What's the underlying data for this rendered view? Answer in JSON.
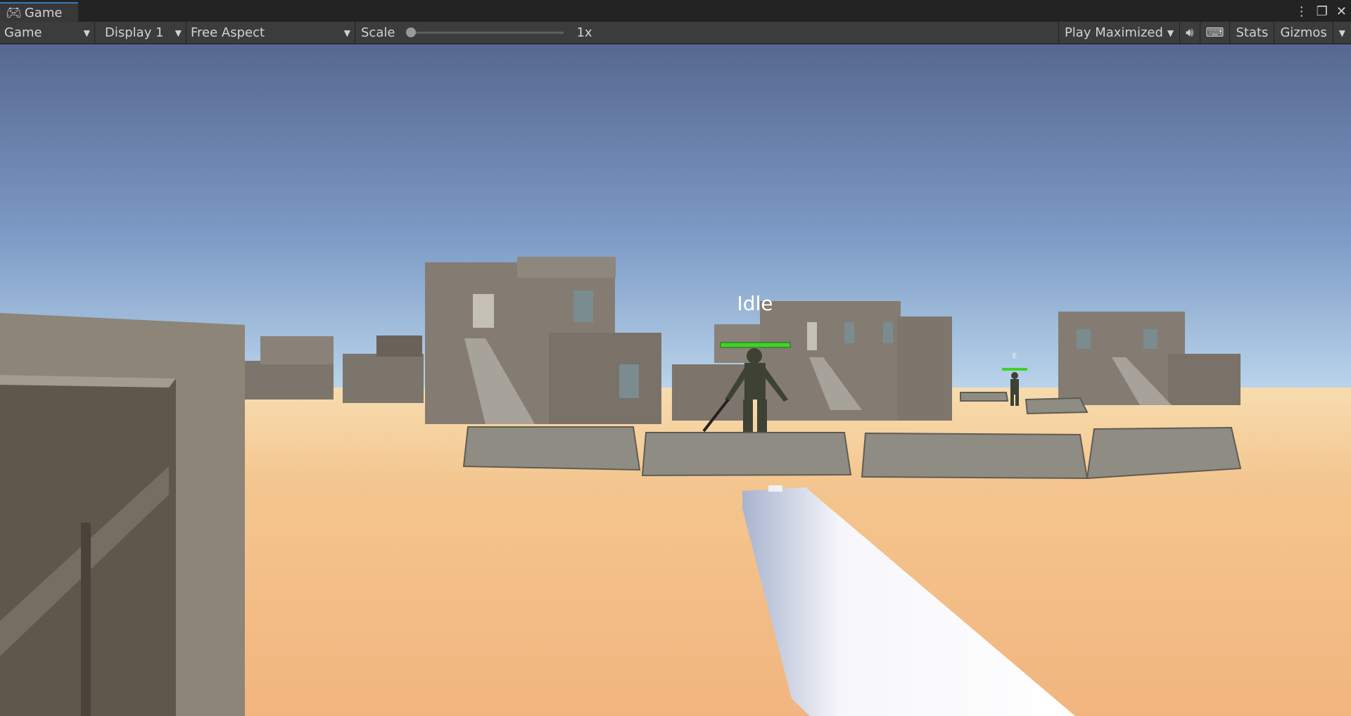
{
  "tab": {
    "icon": "gamepad-icon",
    "label": "Game"
  },
  "toolbar": {
    "mode": "Game",
    "display": "Display 1",
    "aspect": "Free Aspect",
    "scale_label": "Scale",
    "scale_value": "1x",
    "scale_fraction": 0,
    "play_mode": "Play Maximized",
    "stats": "Stats",
    "gizmos": "Gizmos"
  },
  "scene": {
    "enemy_state": "Idle",
    "enemy_health": 1.0,
    "far_enemy_label": "E",
    "far_enemy_health": 1.0,
    "health_color": "#3fd22a"
  }
}
